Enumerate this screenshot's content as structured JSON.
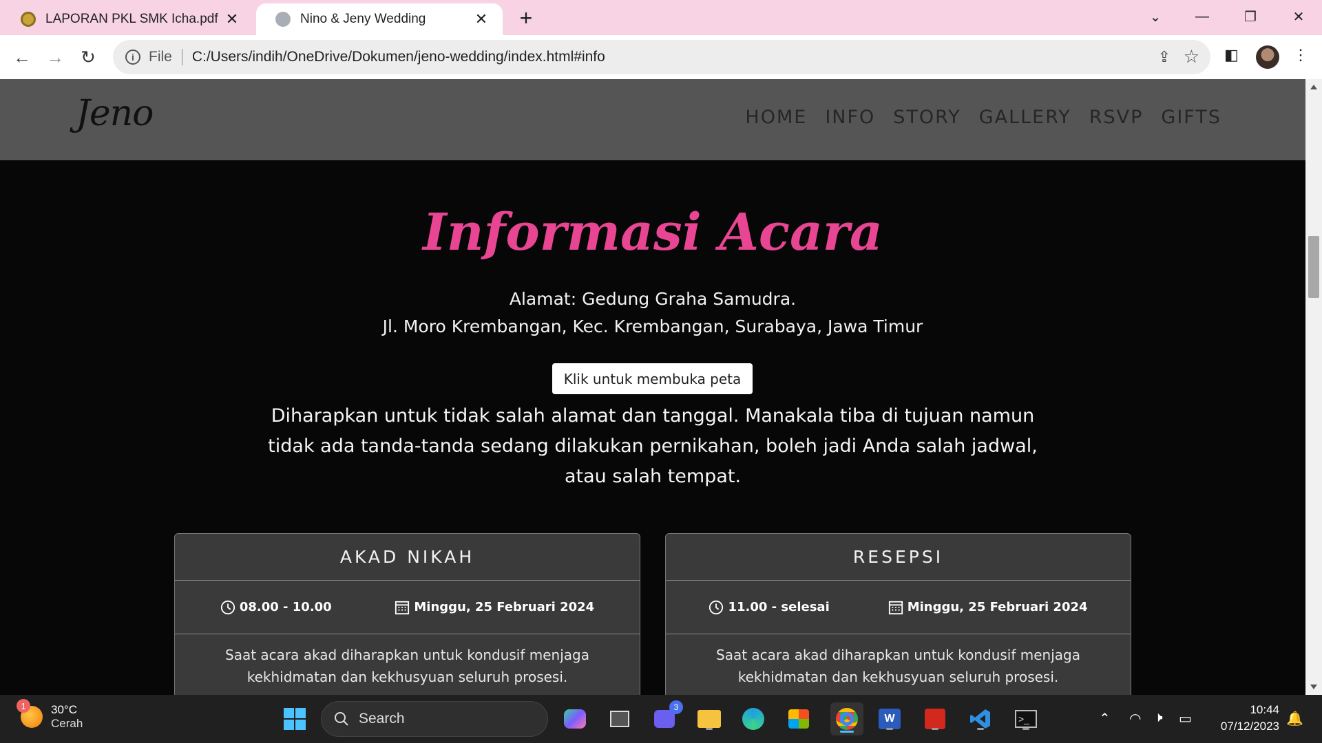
{
  "browser": {
    "tabs": [
      {
        "title": "LAPORAN PKL SMK Icha.pdf",
        "active": false
      },
      {
        "title": "Nino & Jeny Wedding",
        "active": true
      }
    ],
    "scheme_label": "File",
    "url": "C:/Users/indih/OneDrive/Dokumen/jeno-wedding/index.html#info"
  },
  "site": {
    "logo": "Jeno",
    "menu": [
      "HOME",
      "INFO",
      "STORY",
      "GALLERY",
      "RSVP",
      "GIFTS"
    ]
  },
  "info": {
    "heading": "Informasi Acara",
    "address_line1": "Alamat: Gedung Graha Samudra.",
    "address_line2": "Jl. Moro Krembangan, Kec. Krembangan, Surabaya, Jawa Timur",
    "map_button": "Klik untuk membuka peta",
    "notice": "Diharapkan untuk tidak salah alamat dan tanggal. Manakala tiba di tujuan namun tidak ada tanda-tanda sedang dilakukan pernikahan, boleh jadi Anda salah jadwal, atau salah tempat."
  },
  "events": [
    {
      "title": "AKAD NIKAH",
      "time": "08.00 - 10.00",
      "date": "Minggu, 25 Februari 2024",
      "description": "Saat acara akad diharapkan untuk kondusif menjaga kekhidmatan dan kekhusyuan seluruh prosesi."
    },
    {
      "title": "RESEPSI",
      "time": "11.00 - selesai",
      "date": "Minggu, 25 Februari 2024",
      "description": "Saat acara akad diharapkan untuk kondusif menjaga kekhidmatan dan kekhusyuan seluruh prosesi."
    }
  ],
  "taskbar": {
    "weather_temp": "30°C",
    "weather_desc": "Cerah",
    "weather_badge": "1",
    "search_label": "Search",
    "teams_badge": "3",
    "time": "10:44",
    "date": "07/12/2023"
  },
  "colors": {
    "accent_pink": "#e84693",
    "tabstrip": "#f7d3e4",
    "nav_bg": "#555555",
    "card_bg": "#3a3a3a"
  }
}
